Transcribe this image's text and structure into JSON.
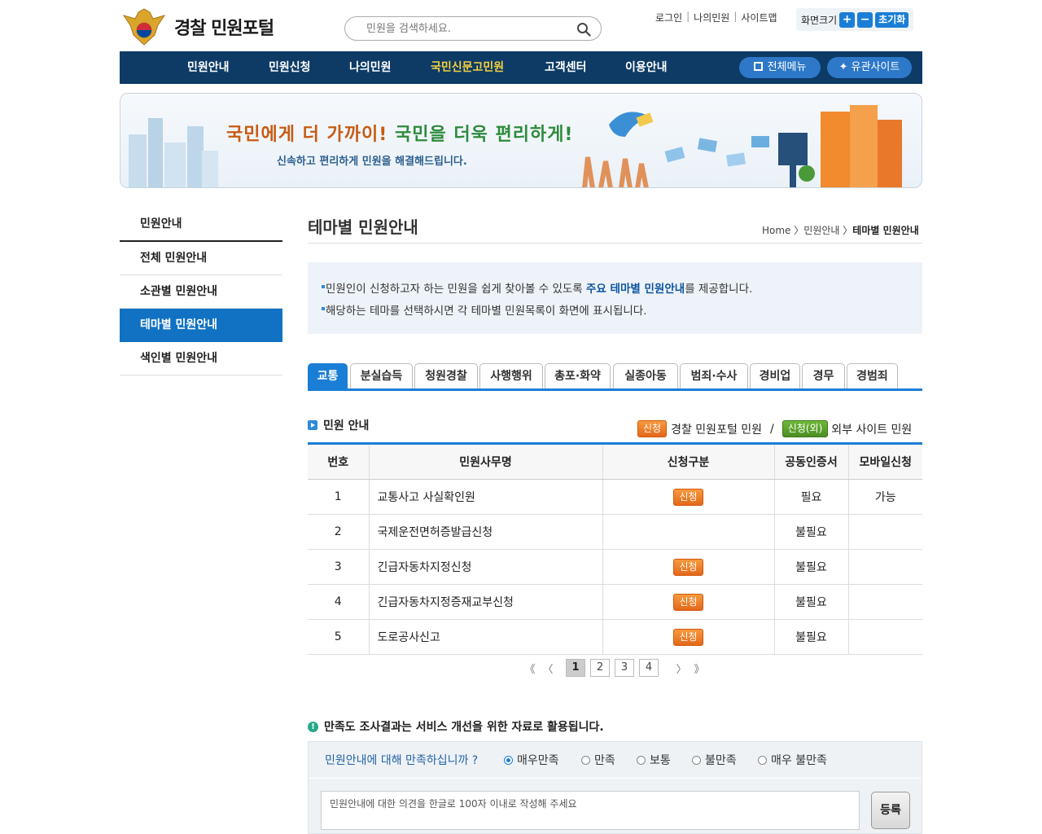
{
  "header": {
    "logo_text": "경찰 민원포털",
    "search_placeholder": "민원을 검색하세요.",
    "util_links": [
      "로그인",
      "나의민원",
      "사이트맵"
    ],
    "font_size_label": "화면크기",
    "font_plus": "+",
    "font_minus": "−",
    "font_reset": "초기화"
  },
  "nav": {
    "items": [
      "민원안내",
      "민원신청",
      "나의민원",
      "국민신문고민원",
      "고객센터",
      "이용안내"
    ],
    "active_index": 3,
    "all_menu": "전체메뉴",
    "related_sites": "유관사이트"
  },
  "banner": {
    "slogan_part1": "국민에게 더 가까이!",
    "slogan_part2": "국민을 더욱 편리하게!",
    "subtitle": "신속하고 편리하게 민원을 해결해드립니다."
  },
  "sidebar": {
    "title": "민원안내",
    "items": [
      "전체 민원안내",
      "소관별 민원안내",
      "테마별 민원안내",
      "색인별 민원안내"
    ],
    "active_index": 2
  },
  "page": {
    "title": "테마별 민원안내",
    "breadcrumb": {
      "home": "Home",
      "level1": "민원안내",
      "current": "테마별 민원안내"
    },
    "info_line1_pre": "민원인이 신청하고자 하는 민원을 쉽게 찾아볼 수 있도록 ",
    "info_line1_hl": "주요 테마별 민원안내",
    "info_line1_post": "를 제공합니다.",
    "info_line2": "해당하는 테마를 선택하시면 각 테마별 민원목록이 화면에 표시됩니다."
  },
  "tabs": [
    "교통",
    "분실습득",
    "청원경찰",
    "사행행위",
    "총포·화약",
    "실종아동",
    "범죄·수사",
    "경비업",
    "경무",
    "경범죄"
  ],
  "active_tab": 0,
  "section": {
    "title": "민원 안내",
    "legend_badge_internal": "신청",
    "legend_internal": "경찰 민원포털 민원",
    "legend_sep": "/",
    "legend_badge_external": "신청(외)",
    "legend_external": "외부 사이트 민원"
  },
  "table": {
    "headers": [
      "번호",
      "민원사무명",
      "신청구분",
      "공동인증서",
      "모바일신청"
    ],
    "apply_label": "신청",
    "rows": [
      {
        "no": "1",
        "name": "교통사고 사실확인원",
        "apply": "신청",
        "cert": "필요",
        "mobile": "가능"
      },
      {
        "no": "2",
        "name": "국제운전면허증발급신청",
        "apply": "",
        "cert": "불필요",
        "mobile": ""
      },
      {
        "no": "3",
        "name": "긴급자동차지정신청",
        "apply": "신청",
        "cert": "불필요",
        "mobile": ""
      },
      {
        "no": "4",
        "name": "긴급자동차지정증재교부신청",
        "apply": "신청",
        "cert": "불필요",
        "mobile": ""
      },
      {
        "no": "5",
        "name": "도로공사신고",
        "apply": "신청",
        "cert": "불필요",
        "mobile": ""
      }
    ]
  },
  "pagination": {
    "first": "《",
    "prev": "〈",
    "pages": [
      "1",
      "2",
      "3",
      "4"
    ],
    "current": "1",
    "next": "〉",
    "last": "》"
  },
  "survey": {
    "title": "만족도 조사결과는 서비스 개선을 위한 자료로 활용됩니다.",
    "question": "민원안내에 대해 만족하십니까 ?",
    "options": [
      "매우만족",
      "만족",
      "보통",
      "불만족",
      "매우 불만족"
    ],
    "selected": "매우만족",
    "placeholder": "민원안내에 대한 의견을 한글로 100자 이내로 작성해 주세요",
    "submit": "등록"
  },
  "colors": {
    "nav_bg": "#0d3b66",
    "accent": "#1b7ed6",
    "active_nav": "#f4d03f",
    "apply_badge": "#e8701f",
    "external_badge": "#4b8f22"
  }
}
